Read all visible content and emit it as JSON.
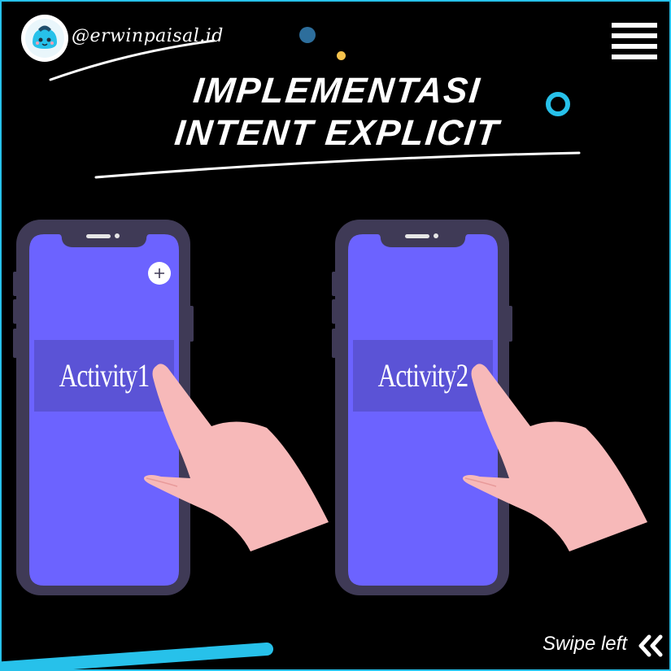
{
  "header": {
    "handle": "@erwinpaisal.id",
    "avatar_icon": "smiling-blob-icon",
    "menu_icon": "hamburger-menu-icon"
  },
  "title": {
    "line1": "IMPLEMENTASI",
    "line2": "INTENT EXPLICIT"
  },
  "phones": [
    {
      "label": "Activity1",
      "has_add_button": true,
      "add_icon": "plus-icon"
    },
    {
      "label": "Activity2",
      "has_add_button": false
    }
  ],
  "footer": {
    "swipe_label": "Swipe left",
    "swipe_icon": "double-chevron-left-icon"
  },
  "colors": {
    "background": "#000000",
    "frame": "#27c1ea",
    "phone_body": "#3f3a56",
    "phone_screen": "#6c63ff",
    "activity_band": "#5b53d6",
    "hand": "#f7b9b9",
    "accent_blue": "#27c1ea",
    "accent_dark_blue": "#2d6e9c",
    "accent_yellow": "#f5c24c"
  }
}
